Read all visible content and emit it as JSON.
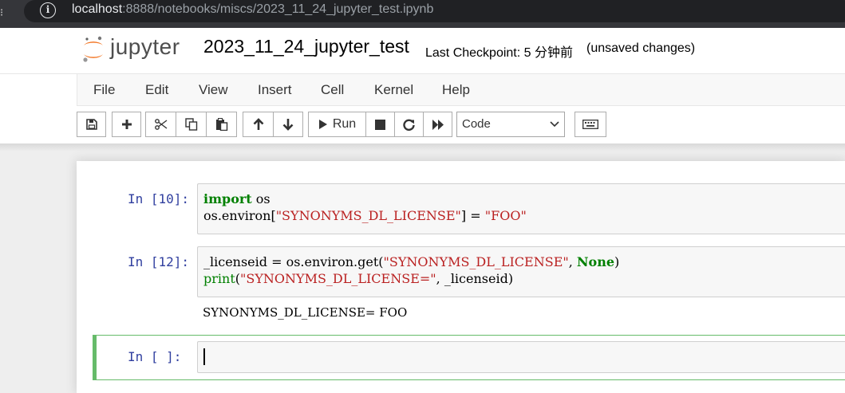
{
  "browser": {
    "url_host": "localhost",
    "url_rest": ":8888/notebooks/miscs/2023_11_24_jupyter_test.ipynb"
  },
  "header": {
    "logo_text": "jupyter",
    "notebook_name": "2023_11_24_jupyter_test",
    "checkpoint": "Last Checkpoint: 5 分钟前",
    "autosave_status": "(unsaved changes)"
  },
  "menu": {
    "items": [
      "File",
      "Edit",
      "View",
      "Insert",
      "Cell",
      "Kernel",
      "Help"
    ]
  },
  "toolbar": {
    "run_label": "Run",
    "cell_type": "Code",
    "icons": [
      "save-icon",
      "plus-icon",
      "cut-icon",
      "copy-icon",
      "paste-icon",
      "arrow-up-icon",
      "arrow-down-icon",
      "play-icon",
      "stop-icon",
      "restart-icon",
      "fast-forward-icon",
      "keyboard-icon"
    ]
  },
  "cells": [
    {
      "prompt": "In [10]:",
      "lines": [
        [
          {
            "t": "import",
            "c": "kw"
          },
          {
            "t": " os",
            "c": ""
          }
        ],
        [
          {
            "t": "os.environ[",
            "c": ""
          },
          {
            "t": "\"SYNONYMS_DL_LICENSE\"",
            "c": "str"
          },
          {
            "t": "] = ",
            "c": ""
          },
          {
            "t": "\"FOO\"",
            "c": "str"
          }
        ]
      ]
    },
    {
      "prompt": "In [12]:",
      "lines": [
        [
          {
            "t": "_licenseid = os.environ.get(",
            "c": ""
          },
          {
            "t": "\"SYNONYMS_DL_LICENSE\"",
            "c": "str"
          },
          {
            "t": ", ",
            "c": ""
          },
          {
            "t": "None",
            "c": "kw"
          },
          {
            "t": ")",
            "c": ""
          }
        ],
        [
          {
            "t": "print",
            "c": "builtin"
          },
          {
            "t": "(",
            "c": ""
          },
          {
            "t": "\"SYNONYMS_DL_LICENSE=\"",
            "c": "str"
          },
          {
            "t": ", _licenseid)",
            "c": ""
          }
        ]
      ],
      "output": "SYNONYMS_DL_LICENSE= FOO"
    },
    {
      "prompt": "In [ ]:",
      "lines": []
    }
  ]
}
